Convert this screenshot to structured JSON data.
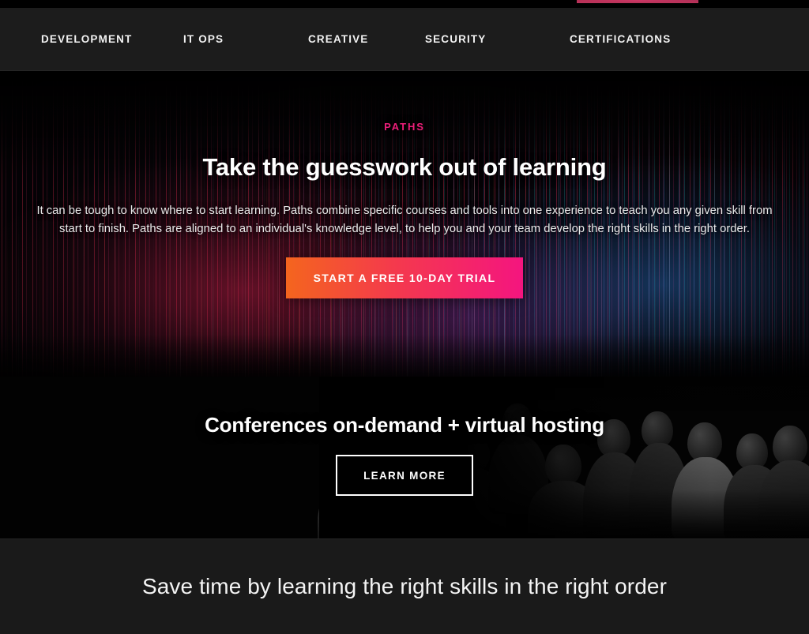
{
  "top_partial": {
    "cutoff_button_label": "",
    "accent_color": "#c4365f"
  },
  "nav": {
    "items": [
      {
        "label": "DEVELOPMENT"
      },
      {
        "label": "IT OPS"
      },
      {
        "label": "CREATIVE"
      },
      {
        "label": "SECURITY"
      },
      {
        "label": "CERTIFICATIONS"
      }
    ]
  },
  "hero": {
    "eyebrow": "PATHS",
    "eyebrow_color": "#ec1e79",
    "title": "Take the guesswork out of learning",
    "body": "It can be tough to know where to start learning. Paths combine specific courses and tools into one experience to teach you any given skill from start to finish. Paths are aligned to an individual's knowledge level, to help you and your team develop the right skills in the right order.",
    "cta_label": "START A FREE 10-DAY TRIAL",
    "cta_gradient_from": "#f4651e",
    "cta_gradient_to": "#f4157f"
  },
  "conferences": {
    "title": "Conferences on-demand + virtual hosting",
    "cta_label": "LEARN MORE",
    "cta_border_color": "#ffffff"
  },
  "bottom": {
    "title": "Save time by learning the right skills in the right order",
    "background_color": "#1a1a1a"
  }
}
